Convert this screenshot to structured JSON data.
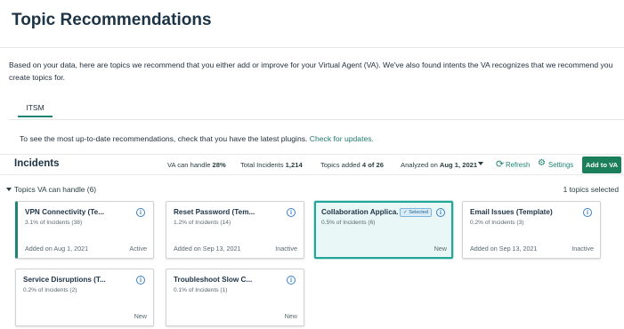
{
  "page": {
    "title": "Topic Recommendations",
    "intro": "Based on your data, here are topics we recommend that you either add or improve for your Virtual Agent (VA). We've also found intents the VA recognizes that we recommend you create topics for."
  },
  "tabs": [
    {
      "label": "ITSM",
      "active": true
    }
  ],
  "hint": {
    "text": "To see the most up-to-date recommendations, check that you have the latest plugins.",
    "link": "Check for updates."
  },
  "toolbar": {
    "heading": "Incidents",
    "va_can_handle_label": "VA can handle",
    "va_can_handle_value": "28%",
    "total_incidents_label": "Total Incidents",
    "total_incidents_value": "1,214",
    "topics_added_label": "Topics added",
    "topics_added_value": "4 of 26",
    "analyzed_label": "Analyzed on",
    "analyzed_value": "Aug 1, 2021",
    "refresh_label": "Refresh",
    "settings_label": "Settings",
    "add_label": "Add to VA",
    "icons": {
      "refresh": "refresh-icon",
      "settings": "gear-icon",
      "dropdown": "chevron-down-icon"
    }
  },
  "group": {
    "label": "Topics VA can handle (6)",
    "selected_count": "1 topics selected"
  },
  "cards": [
    {
      "title": "VPN Connectivity (Te...",
      "sub": "3.1% of Incidents (38)",
      "date": "Added on Aug 1, 2021",
      "status": "Active"
    },
    {
      "title": "Reset Password (Tem...",
      "sub": "1.2% of Incidents (14)",
      "date": "Added on Sep 13, 2021",
      "status": "Inactive"
    },
    {
      "title": "Collaboration Applica...",
      "sub": "0.5% of Incidents (6)",
      "date": "",
      "status": "New",
      "badge": "✓ Selected"
    },
    {
      "title": "Email Issues (Template)",
      "sub": "0.2% of Incidents (3)",
      "date": "Added on Sep 13, 2021",
      "status": "Inactive"
    },
    {
      "title": "Service Disruptions (T...",
      "sub": "0.2% of Incidents (2)",
      "date": "",
      "status": "New"
    },
    {
      "title": "Troubleshoot Slow C...",
      "sub": "0.1% of Incidents (1)",
      "date": "",
      "status": "New"
    }
  ],
  "colors": {
    "accent": "#1f8476",
    "button": "#1c7f5c",
    "selected_bg": "#e9f7f6",
    "info": "#3b7fc4"
  }
}
